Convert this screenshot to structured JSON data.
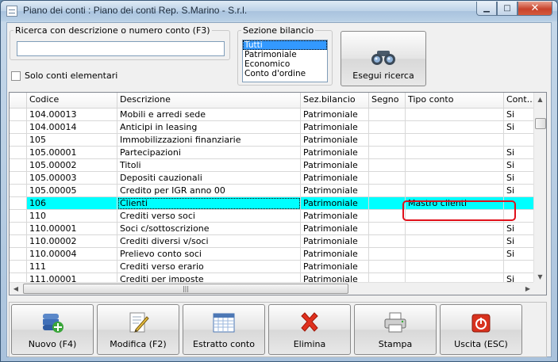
{
  "window": {
    "title": "Piano dei conti : Piano dei conti Rep. S.Marino - S.r.l.",
    "minimize_glyph": "▁",
    "maximize_glyph": "□",
    "close_glyph": "✕"
  },
  "search": {
    "label": "Ricerca con descrizione o numero conto (F3)",
    "value": "",
    "only_elementary_label": "Solo conti elementari",
    "only_elementary_checked": false
  },
  "sezione": {
    "label": "Sezione bilancio",
    "options": [
      "Tutti",
      "Patrimoniale",
      "Economico",
      "Conto d'ordine"
    ],
    "selected": "Tutti"
  },
  "search_button": {
    "label": "Esegui ricerca",
    "icon": "binoculars-icon"
  },
  "grid": {
    "columns": [
      "Codice",
      "Descrizione",
      "Sez.bilancio",
      "Segno",
      "Tipo conto",
      "Cont..."
    ],
    "rows": [
      {
        "code": "104.00013",
        "desc": "Mobili e arredi sede",
        "sez": "Patrimoniale",
        "segno": "",
        "tipo": "",
        "cont": "Si"
      },
      {
        "code": "104.00014",
        "desc": "Anticipi in leasing",
        "sez": "Patrimoniale",
        "segno": "",
        "tipo": "",
        "cont": "Si"
      },
      {
        "code": "105",
        "desc": "Immobilizzazioni finanziarie",
        "sez": "Patrimoniale",
        "segno": "",
        "tipo": "",
        "cont": ""
      },
      {
        "code": "105.00001",
        "desc": "Partecipazioni",
        "sez": "Patrimoniale",
        "segno": "",
        "tipo": "",
        "cont": "Si"
      },
      {
        "code": "105.00002",
        "desc": "Titoli",
        "sez": "Patrimoniale",
        "segno": "",
        "tipo": "",
        "cont": "Si"
      },
      {
        "code": "105.00003",
        "desc": "Depositi cauzionali",
        "sez": "Patrimoniale",
        "segno": "",
        "tipo": "",
        "cont": "Si"
      },
      {
        "code": "105.00005",
        "desc": "Credito per IGR anno 00",
        "sez": "Patrimoniale",
        "segno": "",
        "tipo": "",
        "cont": "Si"
      },
      {
        "code": "106",
        "desc": "Clienti",
        "sez": "Patrimoniale",
        "segno": "",
        "tipo": "Mastro clienti",
        "cont": ""
      },
      {
        "code": "110",
        "desc": "Crediti verso soci",
        "sez": "Patrimoniale",
        "segno": "",
        "tipo": "",
        "cont": ""
      },
      {
        "code": "110.00001",
        "desc": "Soci c/sottoscrizione",
        "sez": "Patrimoniale",
        "segno": "",
        "tipo": "",
        "cont": "Si"
      },
      {
        "code": "110.00002",
        "desc": "Crediti diversi v/soci",
        "sez": "Patrimoniale",
        "segno": "",
        "tipo": "",
        "cont": "Si"
      },
      {
        "code": "110.00004",
        "desc": "Prelievo conto soci",
        "sez": "Patrimoniale",
        "segno": "",
        "tipo": "",
        "cont": "Si"
      },
      {
        "code": "111",
        "desc": "Crediti verso erario",
        "sez": "Patrimoniale",
        "segno": "",
        "tipo": "",
        "cont": ""
      },
      {
        "code": "111.00001",
        "desc": "Crediti per imposte",
        "sez": "Patrimoniale",
        "segno": "",
        "tipo": "",
        "cont": "Si"
      }
    ],
    "selected_row": 7
  },
  "toolbar": {
    "buttons": [
      {
        "label": "Nuovo (F4)",
        "icon": "new-record-icon"
      },
      {
        "label": "Modifica (F2)",
        "icon": "edit-icon"
      },
      {
        "label": "Estratto conto",
        "icon": "calendar-icon"
      },
      {
        "label": "Elimina",
        "icon": "delete-x-icon"
      },
      {
        "label": "Stampa",
        "icon": "printer-icon"
      },
      {
        "label": "Uscita (ESC)",
        "icon": "exit-icon"
      }
    ]
  },
  "colors": {
    "selected_row": "#00ffff",
    "callout": "#e0101a",
    "list_selection": "#3399ff"
  }
}
